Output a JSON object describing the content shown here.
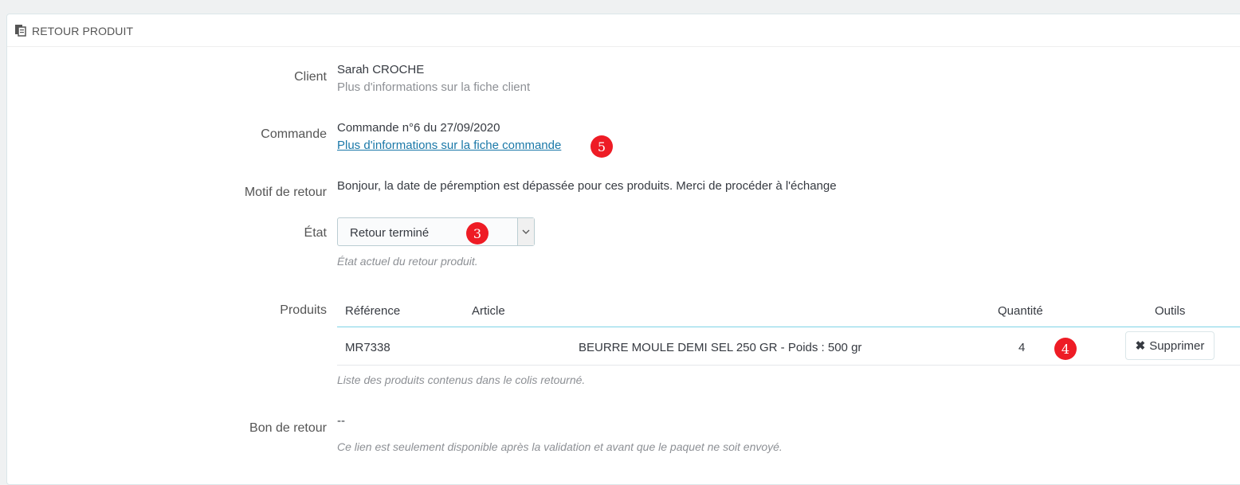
{
  "panel": {
    "title": "RETOUR PRODUIT",
    "icon": "document-copy-icon"
  },
  "client": {
    "label": "Client",
    "name": "Sarah CROCHE",
    "info": "Plus d'informations sur la fiche client"
  },
  "order": {
    "label": "Commande",
    "text": "Commande n°6 du 27/09/2020",
    "link": "Plus d'informations sur la fiche commande",
    "badge": "5"
  },
  "reason": {
    "label": "Motif de retour",
    "text": "Bonjour, la date de péremption est dépassée pour ces produits. Merci de procéder à l'échange"
  },
  "state": {
    "label": "État",
    "selected": "Retour terminé",
    "badge": "3",
    "hint": "État actuel du retour produit."
  },
  "products": {
    "label": "Produits",
    "columns": [
      "Référence",
      "Article",
      "Quantité",
      "Outils"
    ],
    "rows": [
      {
        "reference": "MR7338",
        "article": "BEURRE MOULE DEMI SEL 250 GR - Poids : 500 gr",
        "quantity": "4",
        "badge": "4",
        "action": "Supprimer"
      }
    ],
    "hint": "Liste des produits contenus dans le colis retourné."
  },
  "return_slip": {
    "label": "Bon de retour",
    "value": "--",
    "hint": "Ce lien est seulement disponible après la validation et avant que le paquet ne soit envoyé."
  },
  "colors": {
    "badge": "#ee1c25",
    "link": "#1a78a8",
    "table_header_line": "#7fd3e6"
  }
}
